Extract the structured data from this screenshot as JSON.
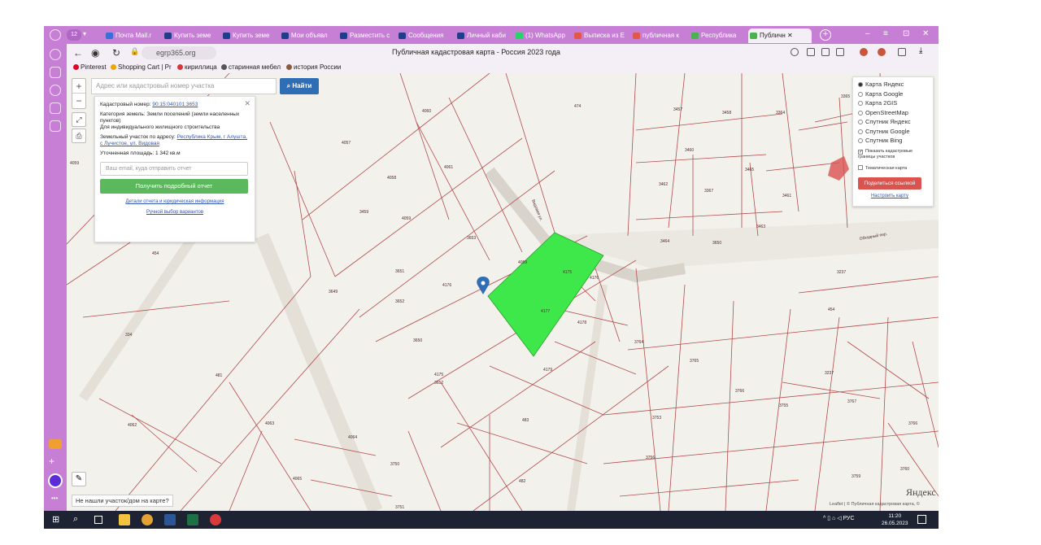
{
  "tabs": [
    {
      "label": "Почта Mail.r",
      "color": "#3a6fd8"
    },
    {
      "label": "Купить земе",
      "color": "#1f3d8a"
    },
    {
      "label": "Купить земе",
      "color": "#1f3d8a"
    },
    {
      "label": "Мои объявл",
      "color": "#1f3d8a"
    },
    {
      "label": "Разместить с",
      "color": "#1f3d8a"
    },
    {
      "label": "Сообщения",
      "color": "#1f3d8a"
    },
    {
      "label": "Личный каби",
      "color": "#1f3d8a"
    },
    {
      "label": "(1) WhatsApp",
      "color": "#25d366"
    },
    {
      "label": "Выписка из Е",
      "color": "#e2574c"
    },
    {
      "label": "публичная к",
      "color": "#e2574c"
    },
    {
      "label": "Республика",
      "color": "#4caf50"
    },
    {
      "label": "Публичн",
      "color": "#4caf50"
    }
  ],
  "address": {
    "url": "egrp365.org",
    "page_title": "Публичная кадастровая карта - Россия 2023 года"
  },
  "bookmarks": [
    {
      "label": "Pinterest",
      "color": "#e60023"
    },
    {
      "label": "Shopping Cart | Pr",
      "color": "#f0a500"
    },
    {
      "label": "кириллица",
      "color": "#d33"
    },
    {
      "label": "старинная мебел",
      "color": "#555"
    },
    {
      "label": "история России",
      "color": "#8a5a3a"
    }
  ],
  "search": {
    "placeholder": "Адрес или кадастровый номер участка",
    "button": "Найти"
  },
  "info": {
    "cad_label": "Кадастровый номер:",
    "cad_value": "90:15:040101:3653",
    "category_label": "Категория земель:",
    "category_value": "Земли поселений (земли населенных пунктов)",
    "use": "Для индивидуального жилищного строительства",
    "address_label": "Земельный участок по адресу:",
    "address_value": "Республика Крым, г Алушта, с Лучистое, ул. Видовая",
    "area_label": "Уточненная площадь:",
    "area_value": "1 342 кв.м",
    "email_placeholder": "Ваш email, куда отправить отчет",
    "report_button": "Получить подробный отчет",
    "details_link": "Детали отчета и юридическая информация",
    "manual_link": "Ручной выбор вариантов"
  },
  "layers": {
    "options": [
      "Карта Яндекс",
      "Карта Google",
      "Карта 2GIS",
      "OpenStreetMap",
      "Спутник Яндекс",
      "Спутник Google",
      "Спутник Bing"
    ],
    "selected": 0,
    "show_borders": "Показать кадастровые границы участков",
    "thematic": "Тематическая карта",
    "share_button": "Поделиться ссылкой",
    "setup_link": "Настроить карту"
  },
  "map": {
    "not_found": "Не нашли участок/дом на карте?",
    "attribution": "Leaflet | © Публичная кадастровая карта, ©",
    "logo": "Яндекс",
    "street_1": "Видовая ул.",
    "street_2": "Обходный пер.",
    "highlight_color": "#3ee84a",
    "border_color": "#b34b4b",
    "parcels": [
      "4060",
      "474",
      "3457",
      "3458",
      "3364",
      "3365",
      "4061",
      "4057",
      "4058",
      "4059",
      "3459",
      "3460",
      "3465",
      "3462",
      "3367",
      "3461",
      "3463",
      "3464",
      "3650",
      "3653",
      "4059",
      "3649",
      "3651",
      "3652",
      "3650",
      "4175",
      "4176",
      "4175",
      "4176",
      "4177",
      "4178",
      "4179",
      "483",
      "482",
      "481",
      "4063",
      "4062",
      "4064",
      "4065",
      "3750",
      "3751",
      "3764",
      "3765",
      "3766",
      "3755",
      "3753",
      "3756",
      "3759",
      "3760",
      "3766",
      "3767",
      "3237",
      "3237",
      "454",
      "454",
      "334",
      "4059",
      "3652"
    ]
  },
  "taskbar": {
    "lang": "РУС",
    "time": "11:20",
    "date": "26.05.2023"
  }
}
